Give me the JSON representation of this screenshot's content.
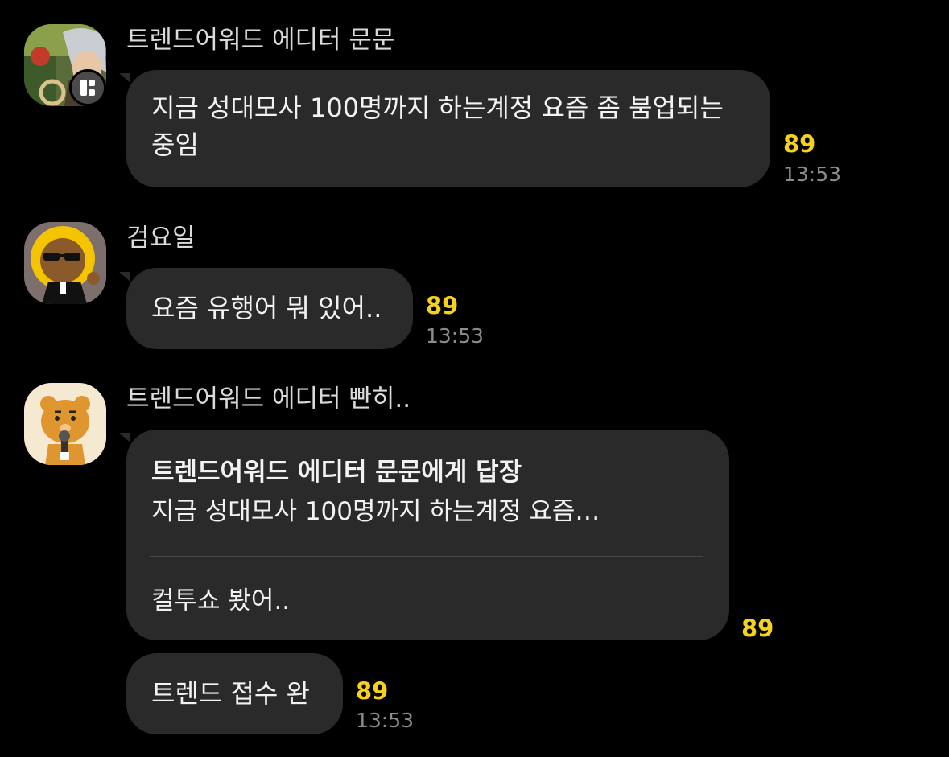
{
  "messages": [
    {
      "sender": "트렌드어워드 에디터 문문",
      "text_lines": [
        "지금 성대모사 100명까지 하는계정 요즘 좀 붐업되는",
        "중임"
      ],
      "unread": "89",
      "time": "13:53"
    },
    {
      "sender": "검요일",
      "text_lines": [
        "요즘 유행어 뭐 있어.."
      ],
      "unread": "89",
      "time": "13:53"
    },
    {
      "sender": "트렌드어워드 에디터 빤히..",
      "reply": {
        "title": "트렌드어워드 에디터 문문에게 답장",
        "quote": "지금 성대모사 100명까지 하는계정 요즘…",
        "text": "컬투쇼 봤어.."
      },
      "unread": "89",
      "follow_up": {
        "text": "트렌드 접수 완",
        "unread": "89",
        "time": "13:53"
      }
    }
  ],
  "icons": {
    "avatar1": "anime-character-avatar",
    "badge": "kakao-profile-badge-icon",
    "avatar2": "sunglasses-lion-avatar",
    "avatar3": "ryan-microphone-avatar"
  },
  "colors": {
    "background": "#000000",
    "bubble": "#2a2a2a",
    "unread": "#f7d21c",
    "time": "#8c8c8c"
  }
}
